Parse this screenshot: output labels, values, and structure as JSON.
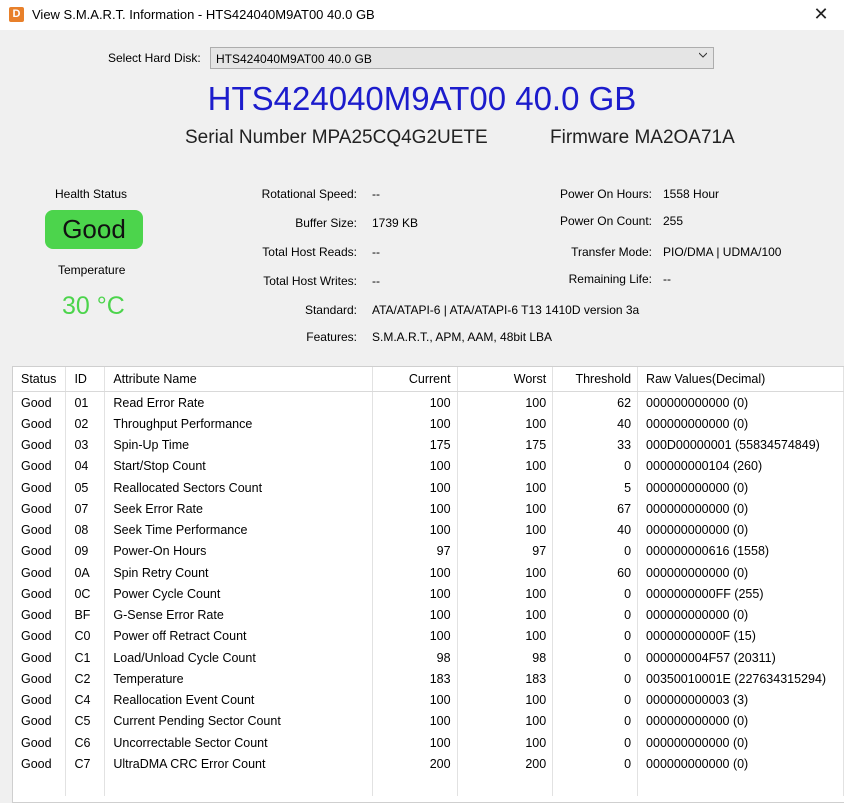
{
  "window": {
    "title": "View S.M.A.R.T. Information - HTS424040M9AT00 40.0 GB",
    "close_glyph": "✕",
    "app_icon_glyph": "D"
  },
  "disk_select": {
    "label": "Select Hard Disk:",
    "value": "HTS424040M9AT00 40.0 GB"
  },
  "model": "HTS424040M9AT00 40.0 GB",
  "serial": "Serial Number MPA25CQ4G2UETE",
  "firmware": "Firmware MA2OA71A",
  "health": {
    "label": "Health Status",
    "value": "Good",
    "color": "#4cd44c"
  },
  "temperature": {
    "label": "Temperature",
    "value": "30 °C"
  },
  "info": {
    "rotational_speed": {
      "label": "Rotational Speed:",
      "value": "--"
    },
    "buffer_size": {
      "label": "Buffer Size:",
      "value": "1739 KB"
    },
    "total_host_reads": {
      "label": "Total Host Reads:",
      "value": "--"
    },
    "total_host_writes": {
      "label": "Total Host Writes:",
      "value": "--"
    },
    "standard": {
      "label": "Standard:",
      "value": "ATA/ATAPI-6 | ATA/ATAPI-6 T13 1410D version 3a"
    },
    "features": {
      "label": "Features:",
      "value": "S.M.A.R.T., APM, AAM, 48bit LBA"
    },
    "power_on_hours": {
      "label": "Power On Hours:",
      "value": "1558 Hour"
    },
    "power_on_count": {
      "label": "Power On Count:",
      "value": "255"
    },
    "transfer_mode": {
      "label": "Transfer Mode:",
      "value": "PIO/DMA | UDMA/100"
    },
    "remaining_life": {
      "label": "Remaining Life:",
      "value": "--"
    }
  },
  "table": {
    "headers": [
      "Status",
      "ID",
      "Attribute Name",
      "Current",
      "Worst",
      "Threshold",
      "Raw Values(Decimal)"
    ],
    "rows": [
      [
        "Good",
        "01",
        "Read Error Rate",
        "100",
        "100",
        "62",
        "000000000000 (0)"
      ],
      [
        "Good",
        "02",
        "Throughput Performance",
        "100",
        "100",
        "40",
        "000000000000 (0)"
      ],
      [
        "Good",
        "03",
        "Spin-Up Time",
        "175",
        "175",
        "33",
        "000D00000001 (55834574849)"
      ],
      [
        "Good",
        "04",
        "Start/Stop Count",
        "100",
        "100",
        "0",
        "000000000104 (260)"
      ],
      [
        "Good",
        "05",
        "Reallocated Sectors Count",
        "100",
        "100",
        "5",
        "000000000000 (0)"
      ],
      [
        "Good",
        "07",
        "Seek Error Rate",
        "100",
        "100",
        "67",
        "000000000000 (0)"
      ],
      [
        "Good",
        "08",
        "Seek Time Performance",
        "100",
        "100",
        "40",
        "000000000000 (0)"
      ],
      [
        "Good",
        "09",
        "Power-On Hours",
        "97",
        "97",
        "0",
        "000000000616 (1558)"
      ],
      [
        "Good",
        "0A",
        "Spin Retry Count",
        "100",
        "100",
        "60",
        "000000000000 (0)"
      ],
      [
        "Good",
        "0C",
        "Power Cycle Count",
        "100",
        "100",
        "0",
        "0000000000FF (255)"
      ],
      [
        "Good",
        "BF",
        "G-Sense Error Rate",
        "100",
        "100",
        "0",
        "000000000000 (0)"
      ],
      [
        "Good",
        "C0",
        "Power off Retract Count",
        "100",
        "100",
        "0",
        "00000000000F (15)"
      ],
      [
        "Good",
        "C1",
        "Load/Unload Cycle Count",
        "98",
        "98",
        "0",
        "000000004F57 (20311)"
      ],
      [
        "Good",
        "C2",
        "Temperature",
        "183",
        "183",
        "0",
        "00350010001E (227634315294)"
      ],
      [
        "Good",
        "C4",
        "Reallocation Event Count",
        "100",
        "100",
        "0",
        "000000000003 (3)"
      ],
      [
        "Good",
        "C5",
        "Current Pending Sector Count",
        "100",
        "100",
        "0",
        "000000000000 (0)"
      ],
      [
        "Good",
        "C6",
        "Uncorrectable Sector Count",
        "100",
        "100",
        "0",
        "000000000000 (0)"
      ],
      [
        "Good",
        "C7",
        "UltraDMA CRC Error Count",
        "200",
        "200",
        "0",
        "000000000000 (0)"
      ]
    ]
  }
}
